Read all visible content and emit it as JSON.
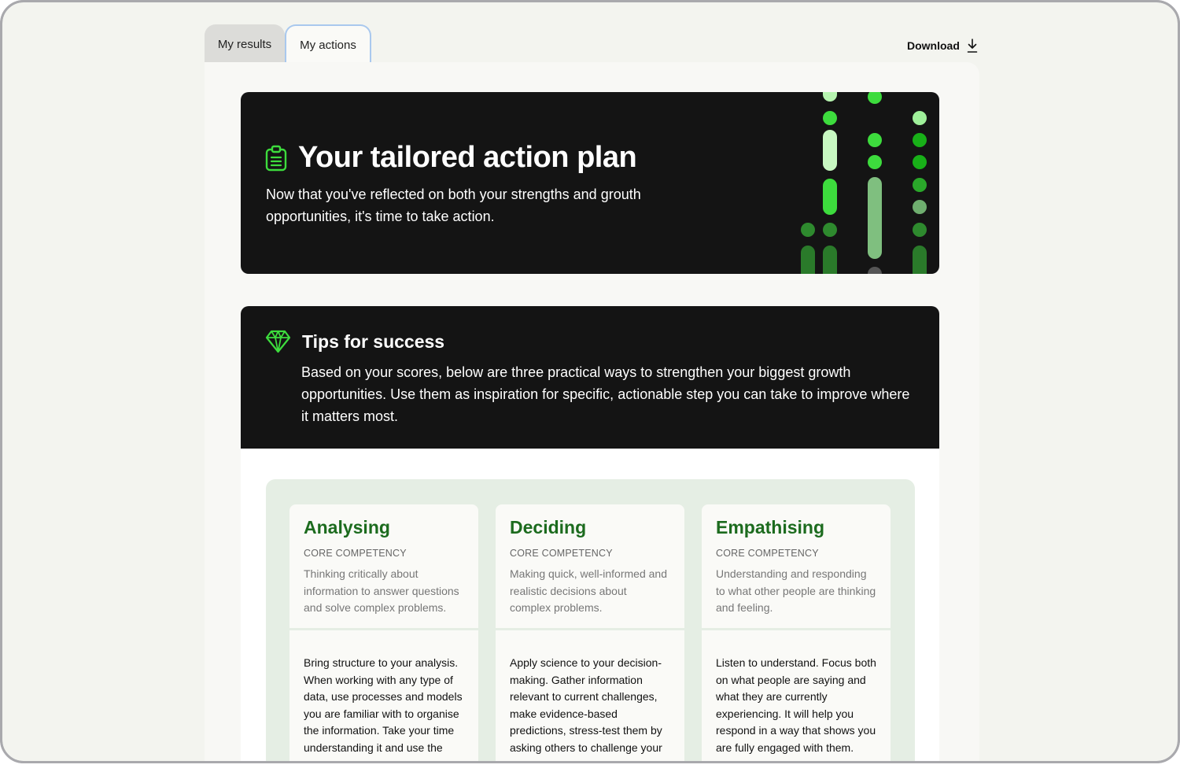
{
  "tabs": [
    {
      "label": "My results"
    },
    {
      "label": "My actions"
    }
  ],
  "download": {
    "label": "Download",
    "icon": "download-icon"
  },
  "hero": {
    "icon": "clipboard-icon",
    "title": "Your tailored action plan",
    "subtitle": "Now that you've reflected on both your strengths and grouth opportunities, it's time to take action."
  },
  "tips": {
    "icon": "diamond-icon",
    "title": "Tips for success",
    "body": "Based on your scores, below are three practical ways to strengthen your biggest growth opportunities. Use them as inspiration for specific, actionable step you can take to improve where it matters most."
  },
  "cards": [
    {
      "title": "Analysing",
      "label": "CORE COMPETENCY",
      "description": "Thinking critically about information to answer questions and solve complex problems.",
      "body": "Bring structure to your analysis. When working with any type of data, use processes and models you are familiar with to organise the information. Take your time understanding it and use the"
    },
    {
      "title": "Deciding",
      "label": "CORE COMPETENCY",
      "description": "Making quick, well-informed and realistic decisions about complex problems.",
      "body": "Apply science to your decision-making. Gather information relevant to current challenges, make evidence-based predictions, stress-test them by asking others to challenge your"
    },
    {
      "title": "Empathising",
      "label": "CORE COMPETENCY",
      "description": "Understanding and responding to what other people are thinking and feeling.",
      "body": "Listen to understand. Focus both on what people are saying and what they are currently experiencing. It will help you respond in a way that shows you are fully engaged with them."
    }
  ],
  "colors": {
    "accent_green": "#1c6b1e",
    "bright_green": "#3ddc3d",
    "dark_panel": "#141414",
    "tab_focus_border": "#a9c8ee"
  }
}
